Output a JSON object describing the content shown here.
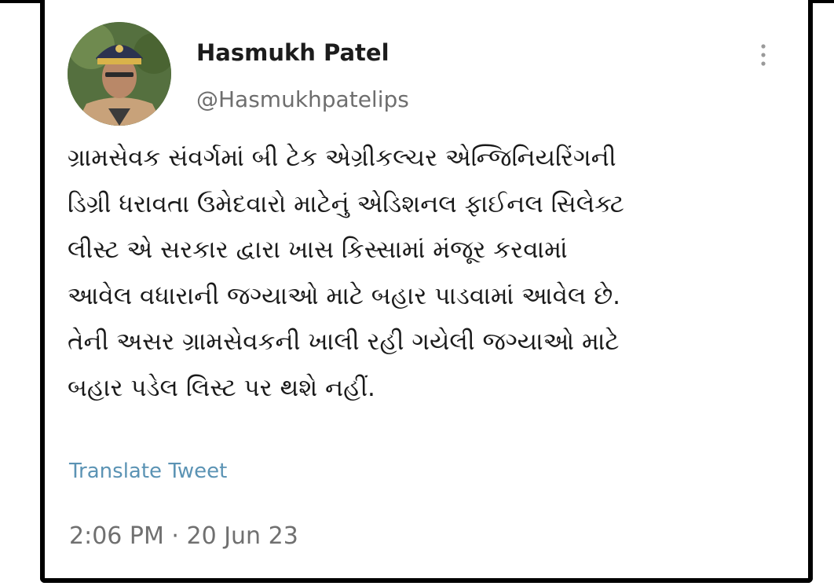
{
  "tweet": {
    "author": {
      "display_name": "Hasmukh Patel",
      "handle": "@Hasmukhpatelips"
    },
    "more_icon": "vertical-ellipsis-icon",
    "text_lines": [
      "ગ્રામસેવક સંવર્ગમાં બી ટેક એગ્રીકલ્ચર એન્જિનિયરિંગની",
      "ડિગ્રી ધરાવતા ઉમેદવારો માટેનું એડિશનલ ફાઈનલ સિલેક્ટ",
      "લીસ્ટ એ સરકાર દ્વારા  ખાસ કિસ્સામાં મંજૂર કરવામાં",
      "આવેલ વધારાની જગ્યાઓ માટે બહાર પાડવામાં આવેલ છે.",
      "તેની અસર ગ્રામસેવકની ખાલી રહી ગયેલી જગ્યાઓ માટે",
      "બહાર પડેલ લિસ્ટ પર થશે નહીં."
    ],
    "translate_label": "Translate Tweet",
    "timestamp": "2:06 PM · 20 Jun 23"
  },
  "colors": {
    "link": "#5b93b4",
    "muted": "#707070",
    "frame": "#000000"
  }
}
